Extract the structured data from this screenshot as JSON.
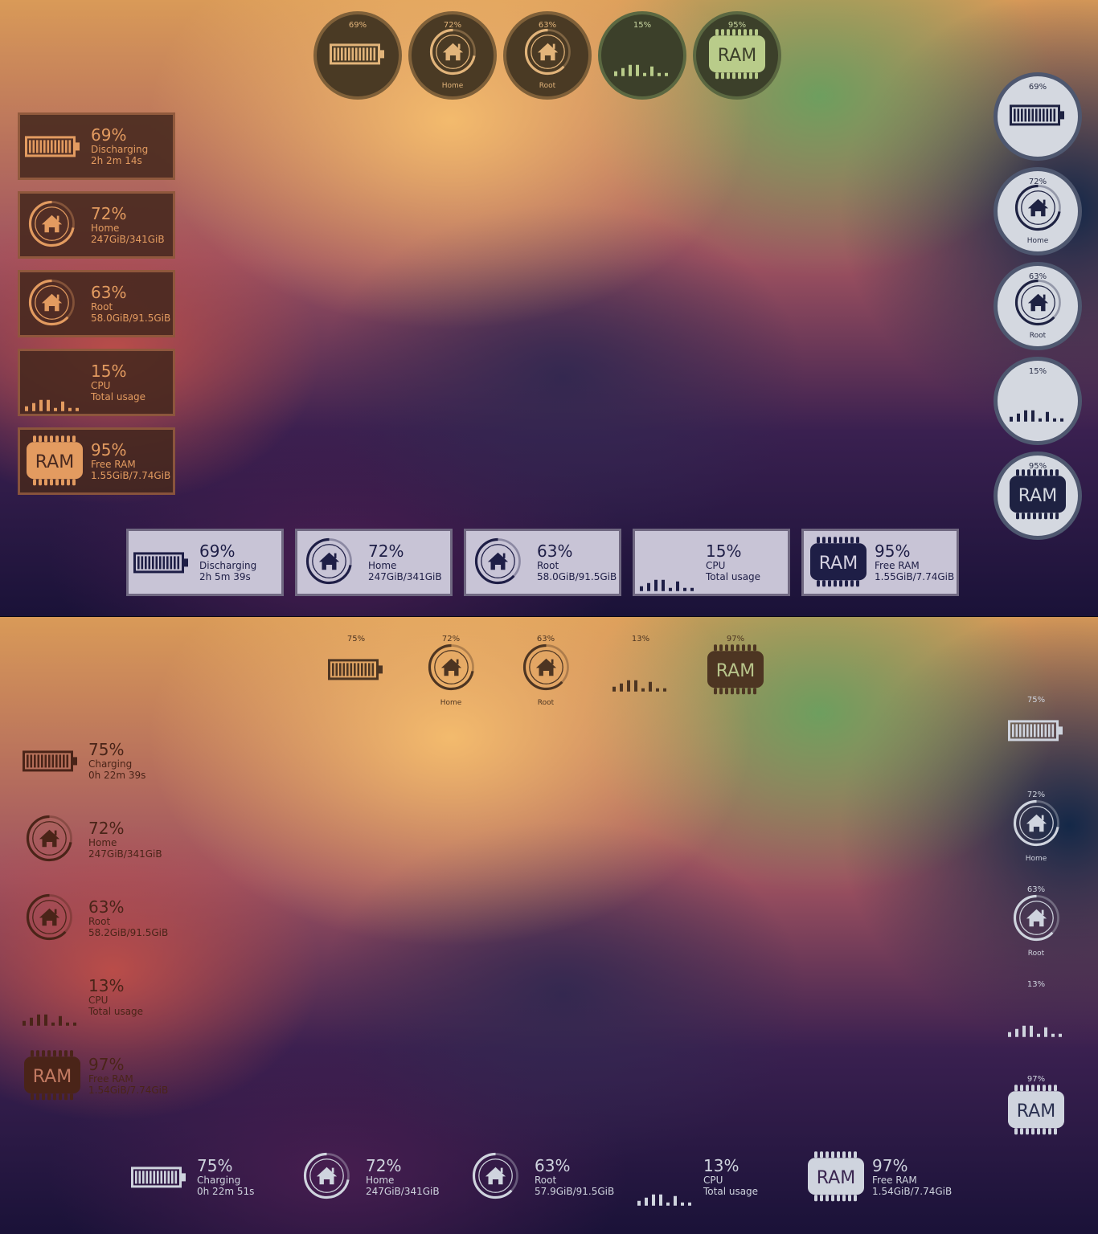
{
  "top_desktop": {
    "top_circles": [
      {
        "kind": "battery",
        "percent": "69%",
        "label": ""
      },
      {
        "kind": "disk",
        "percent": "72%",
        "label": "Home"
      },
      {
        "kind": "disk",
        "percent": "63%",
        "label": "Root"
      },
      {
        "kind": "cpu",
        "percent": "15%",
        "label": ""
      },
      {
        "kind": "ram",
        "percent": "95%",
        "label": "",
        "icon_text": "RAM"
      }
    ],
    "left_panels": [
      {
        "kind": "battery",
        "percent": "69%",
        "line1": "Discharging",
        "line2": "2h 2m 14s"
      },
      {
        "kind": "disk",
        "percent": "72%",
        "line1": "Home",
        "line2": "247GiB/341GiB"
      },
      {
        "kind": "disk",
        "percent": "63%",
        "line1": "Root",
        "line2": "58.0GiB/91.5GiB"
      },
      {
        "kind": "cpu",
        "percent": "15%",
        "line1": "CPU",
        "line2": "Total usage"
      },
      {
        "kind": "ram",
        "percent": "95%",
        "line1": "Free RAM",
        "line2": "1.55GiB/7.74GiB",
        "icon_text": "RAM"
      }
    ],
    "right_circles": [
      {
        "kind": "battery",
        "percent": "69%",
        "label": ""
      },
      {
        "kind": "disk",
        "percent": "72%",
        "label": "Home"
      },
      {
        "kind": "disk",
        "percent": "63%",
        "label": "Root"
      },
      {
        "kind": "cpu",
        "percent": "15%",
        "label": ""
      },
      {
        "kind": "ram",
        "percent": "95%",
        "label": "",
        "icon_text": "RAM"
      }
    ],
    "bottom_panels": [
      {
        "kind": "battery",
        "percent": "69%",
        "line1": "Discharging",
        "line2": "2h 5m 39s"
      },
      {
        "kind": "disk",
        "percent": "72%",
        "line1": "Home",
        "line2": "247GiB/341GiB"
      },
      {
        "kind": "disk",
        "percent": "63%",
        "line1": "Root",
        "line2": "58.0GiB/91.5GiB"
      },
      {
        "kind": "cpu",
        "percent": "15%",
        "line1": "CPU",
        "line2": "Total usage"
      },
      {
        "kind": "ram",
        "percent": "95%",
        "line1": "Free RAM",
        "line2": "1.55GiB/7.74GiB",
        "icon_text": "RAM"
      }
    ]
  },
  "bottom_desktop": {
    "top_items": [
      {
        "kind": "battery",
        "percent": "75%",
        "label": ""
      },
      {
        "kind": "disk",
        "percent": "72%",
        "label": "Home"
      },
      {
        "kind": "disk",
        "percent": "63%",
        "label": "Root"
      },
      {
        "kind": "cpu",
        "percent": "13%",
        "label": ""
      },
      {
        "kind": "ram",
        "percent": "97%",
        "label": "",
        "icon_text": "RAM"
      }
    ],
    "left_items": [
      {
        "kind": "battery",
        "percent": "75%",
        "line1": "Charging",
        "line2": "0h 22m 39s"
      },
      {
        "kind": "disk",
        "percent": "72%",
        "line1": "Home",
        "line2": "247GiB/341GiB"
      },
      {
        "kind": "disk",
        "percent": "63%",
        "line1": "Root",
        "line2": "58.2GiB/91.5GiB"
      },
      {
        "kind": "cpu",
        "percent": "13%",
        "line1": "CPU",
        "line2": "Total usage"
      },
      {
        "kind": "ram",
        "percent": "97%",
        "line1": "Free RAM",
        "line2": "1.54GiB/7.74GiB",
        "icon_text": "RAM"
      }
    ],
    "right_items": [
      {
        "kind": "battery",
        "percent": "75%",
        "label": ""
      },
      {
        "kind": "disk",
        "percent": "72%",
        "label": "Home"
      },
      {
        "kind": "disk",
        "percent": "63%",
        "label": "Root"
      },
      {
        "kind": "cpu",
        "percent": "13%",
        "label": ""
      },
      {
        "kind": "ram",
        "percent": "97%",
        "label": "",
        "icon_text": "RAM"
      }
    ],
    "bottom_items": [
      {
        "kind": "battery",
        "percent": "75%",
        "line1": "Charging",
        "line2": "0h 22m 51s"
      },
      {
        "kind": "disk",
        "percent": "72%",
        "line1": "Home",
        "line2": "247GiB/341GiB"
      },
      {
        "kind": "disk",
        "percent": "63%",
        "line1": "Root",
        "line2": "57.9GiB/91.5GiB"
      },
      {
        "kind": "cpu",
        "percent": "13%",
        "line1": "CPU",
        "line2": "Total usage"
      },
      {
        "kind": "ram",
        "percent": "97%",
        "line1": "Free RAM",
        "line2": "1.54GiB/7.74GiB",
        "icon_text": "RAM"
      }
    ]
  },
  "colors": {
    "orange_text": "#e39b60",
    "tan_text": "#e2b47a",
    "navy_text": "#1e1e46",
    "pale_text": "#cfd4de",
    "brown_text": "#4d3522"
  }
}
